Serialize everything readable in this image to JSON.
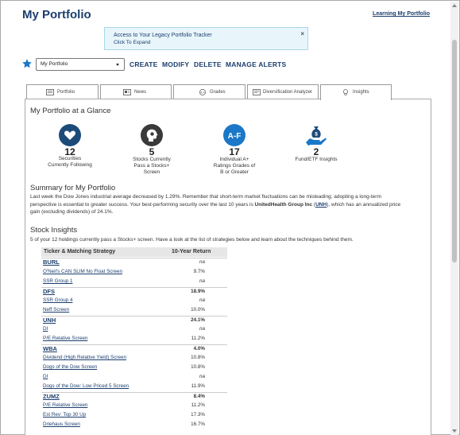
{
  "header": {
    "title": "My Portfolio",
    "top_link": "Learning My Portfolio"
  },
  "notice": {
    "line1": "Access to Your Legacy Portfolio Tracker",
    "line2": "Click To Expand",
    "close": "×"
  },
  "toolbar": {
    "select_value": "My Portfolio",
    "create": "CREATE",
    "modify": "MODIFY",
    "delete": "DELETE",
    "manage_alerts": "MANAGE ALERTS"
  },
  "tabs": [
    {
      "label": "Portfolio",
      "icon": "portfolio-icon"
    },
    {
      "label": "News",
      "icon": "news-icon"
    },
    {
      "label": "Grades",
      "icon": "grades-icon"
    },
    {
      "label": "Diversification Analyzer",
      "icon": "analyzer-icon"
    },
    {
      "label": "Insights",
      "icon": "lightbulb-icon",
      "active": true
    }
  ],
  "glance": {
    "heading": "My Portfolio at a Glance",
    "stats": [
      {
        "value": "12",
        "label_l1": "Securities",
        "label_l2": "Currently Following",
        "label_l3": "",
        "icon": "heart-icon",
        "color": "#1c4b7a"
      },
      {
        "value": "5",
        "label_l1": "Stocks Currently",
        "label_l2": "Pass a Stocks+",
        "label_l3": "Screen",
        "icon": "head-gear-icon",
        "color": "#333333"
      },
      {
        "value": "17",
        "label_l1": "Individual A+",
        "label_l2": "Ratings Grades of",
        "label_l3": "B or Greater",
        "icon": "grade-af-icon",
        "color": "#1b78c8",
        "icon_text": "A-F"
      },
      {
        "value": "2",
        "label_l1": "Fund/ETF Insights",
        "label_l2": "",
        "label_l3": "",
        "icon": "money-hand-icon",
        "color": "#1c4b7a"
      }
    ]
  },
  "summary": {
    "heading": "Summary for My Portfolio",
    "line1": "Last week the Dow Jones industrial average decreased by 1.29%. Remember that short-term market fluctuations can be misleading; adopting a long-term",
    "line2_pre": "perspective is essential to greater success. Your best-performing security over the last 10 years is ",
    "line2_bold": "UnitedHealth Group Inc",
    "line2_link": "UNH",
    "line2_post": ", which has an annualized price",
    "line3": "gain (excluding dividends) of 24.1%."
  },
  "insights": {
    "heading": "Stock Insights",
    "intro": "5 of your 12 holdings currently pass a Stocks+ screen. Have a look at the list of strategies below and learn about the techniques behind them.",
    "col_ticker": "Ticker & Matching Strategy",
    "col_return": "10-Year Return",
    "rows": [
      {
        "name": "BURL",
        "ret": "na",
        "ticker": true
      },
      {
        "name": "O'Neil's CAN SLIM No Float Screen",
        "ret": "9.7%"
      },
      {
        "name": "SSR Group 1",
        "ret": "na"
      },
      {
        "name": "DFS",
        "ret": "18.9%",
        "ticker": true
      },
      {
        "name": "SSR Group 4",
        "ret": "na"
      },
      {
        "name": "Neff Screen",
        "ret": "10.0%"
      },
      {
        "name": "UNH",
        "ret": "24.1%",
        "ticker": true
      },
      {
        "name": "DI",
        "ret": "na"
      },
      {
        "name": "P/E Relative Screen",
        "ret": "11.2%"
      },
      {
        "name": "WBA",
        "ret": "4.0%",
        "ticker": true
      },
      {
        "name": "Dividend (High Relative Yield) Screen",
        "ret": "10.8%"
      },
      {
        "name": "Dogs of the Dow Screen",
        "ret": "10.8%"
      },
      {
        "name": "DI",
        "ret": "na"
      },
      {
        "name": "Dogs of the Dow: Low Priced 5 Screen",
        "ret": "11.9%"
      },
      {
        "name": "ZUMZ",
        "ret": "8.4%",
        "ticker": true
      },
      {
        "name": "P/E Relative Screen",
        "ret": "11.2%"
      },
      {
        "name": "Est Rev: Top 30 Up",
        "ret": "17.3%"
      },
      {
        "name": "Driehaus Screen",
        "ret": "16.7%"
      }
    ]
  }
}
